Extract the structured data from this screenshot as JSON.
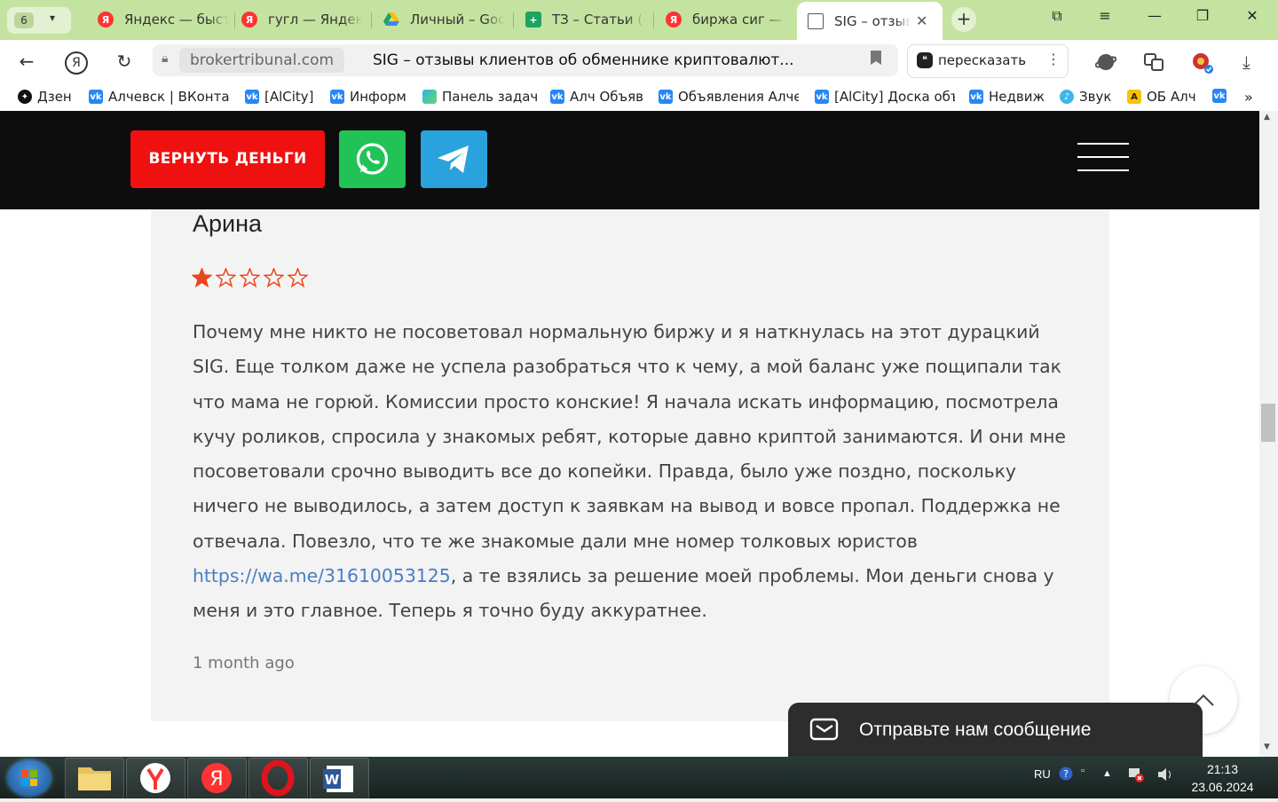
{
  "browser": {
    "tab_count": "6",
    "tabs": [
      {
        "title": "Яндекс — быстрый поиск в интернете",
        "favicon": "yandex-icon"
      },
      {
        "title": "гугл — Яндекс: нашлось",
        "favicon": "yandex-icon"
      },
      {
        "title": "Личный – Google Диск",
        "favicon": "google-drive-icon"
      },
      {
        "title": "ТЗ – Статьи (Google Таблицы)",
        "favicon": "google-sheets-icon"
      },
      {
        "title": "биржа сиг — Яндекс",
        "favicon": "yandex-icon"
      },
      {
        "title": "SIG – отзывы",
        "favicon": "page-icon",
        "active": true
      }
    ],
    "address": {
      "domain": "brokertribunal.com",
      "page_title": "SIG – отзывы клиентов об обменнике криптовалют..."
    },
    "retell_label": "пересказать",
    "bookmarks": [
      {
        "label": "Дзен",
        "icon": "dzen-icon"
      },
      {
        "label": "Алчевск | ВКонтакте",
        "icon": "vk-icon"
      },
      {
        "label": "[AlCity]",
        "icon": "vk-icon"
      },
      {
        "label": "Информ",
        "icon": "vk-icon"
      },
      {
        "label": "Панель задач",
        "icon": "chart-icon"
      },
      {
        "label": "Алч Объяв",
        "icon": "vk-icon"
      },
      {
        "label": "Объявления Алчевск",
        "icon": "vk-icon"
      },
      {
        "label": "[AlCity] Доска объявлений",
        "icon": "vk-icon"
      },
      {
        "label": "Недвиж",
        "icon": "vk-icon"
      },
      {
        "label": "Звук",
        "icon": "sound-icon"
      },
      {
        "label": "ОБ Алч",
        "icon": "a-icon"
      }
    ]
  },
  "site": {
    "refund_button": "ВЕРНУТЬ ДЕНЬГИ",
    "review": {
      "author": "Арина",
      "rating": 1,
      "rating_max": 5,
      "text_before_link": "Почему мне никто не посоветовал нормальную биржу и я наткнулась на этот дурацкий SIG. Еще толком даже не успела разобраться что к чему, а мой баланс уже пощипали так что мама не горюй. Комиссии просто конские! Я начала искать информацию, посмотрела кучу роликов, спросила у знакомых ребят, которые давно криптой занимаются. И они мне посоветовали срочно выводить все до копейки. Правда, было уже поздно, поскольку ничего не выводилось, а затем доступ к заявкам на вывод и вовсе пропал. Поддержка не отвечала. Повезло, что те же знакомые дали мне номер толковых юристов ",
      "link": "https://wa.me/31610053125",
      "text_after_link": ", а те взялись за решение моей проблемы. Мои деньги снова у меня и это главное. Теперь я точно буду аккуратнее.",
      "age": "1 month ago"
    },
    "message_widget": "Отправьте нам сообщение",
    "colors": {
      "refund": "#f01010",
      "whatsapp": "#22c356",
      "telegram": "#2aa2dd",
      "star": "#e8461e",
      "link": "#4a7fc4"
    }
  },
  "taskbar": {
    "lang": "RU",
    "time": "21:13",
    "date": "23.06.2024"
  }
}
